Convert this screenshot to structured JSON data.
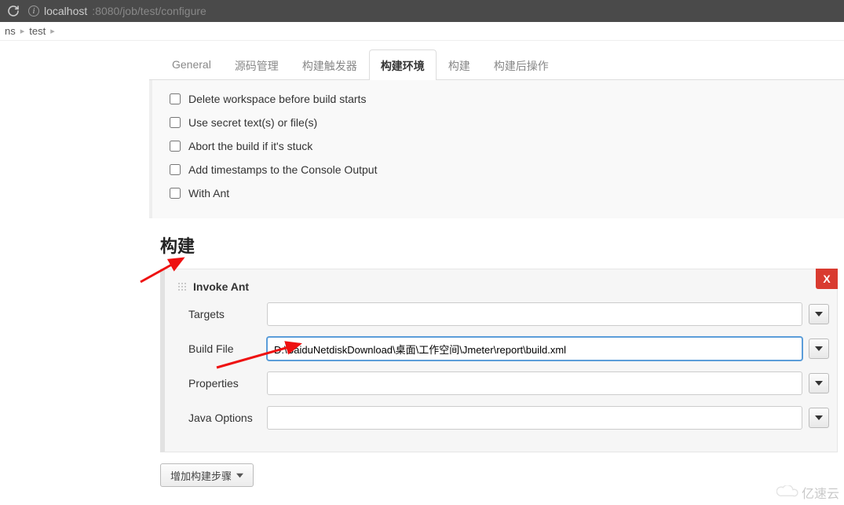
{
  "browser": {
    "url_host": "localhost",
    "url_path": ":8080/job/test/configure"
  },
  "breadcrumb": {
    "item1": "ns",
    "item2": "test"
  },
  "tabs": {
    "general": "General",
    "scm": "源码管理",
    "triggers": "构建触发器",
    "env": "构建环境",
    "build": "构建",
    "post": "构建后操作"
  },
  "env_checks": {
    "c1": "Delete workspace before build starts",
    "c2": "Use secret text(s) or file(s)",
    "c3": "Abort the build if it's stuck",
    "c4": "Add timestamps to the Console Output",
    "c5": "With Ant"
  },
  "build": {
    "heading": "构建",
    "block_title": "Invoke Ant",
    "close": "X",
    "labels": {
      "targets": "Targets",
      "build_file": "Build File",
      "properties": "Properties",
      "java_opts": "Java Options"
    },
    "values": {
      "targets": "",
      "build_file": "D:\\BaiduNetdiskDownload\\桌面\\工作空间\\Jmeter\\report\\build.xml",
      "properties": "",
      "java_opts": ""
    },
    "add_step": "增加构建步骤"
  },
  "watermark": "亿速云"
}
